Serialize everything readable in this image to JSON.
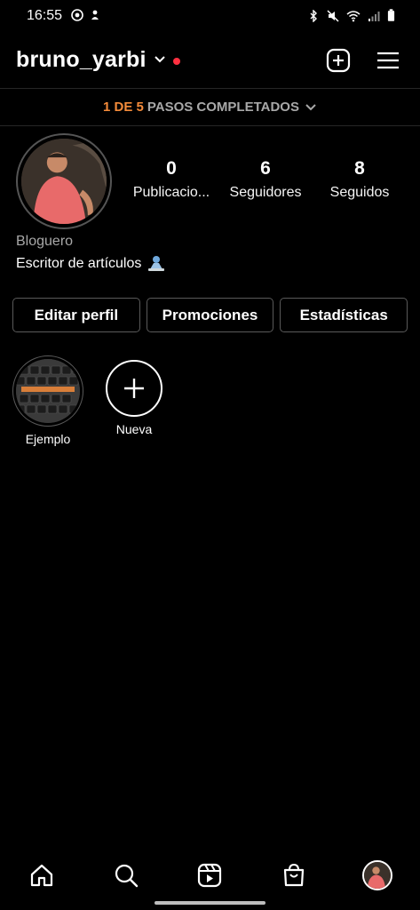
{
  "status_bar": {
    "time": "16:55",
    "left_icons": [
      "media-icon",
      "notification-icon"
    ],
    "right_icons": [
      "bluetooth-icon",
      "mute-icon",
      "wifi-icon",
      "signal-icon",
      "battery-icon"
    ]
  },
  "header": {
    "username": "bruno_yarbi",
    "has_notification_dot": true,
    "notification_dot_color": "#ff3040"
  },
  "steps": {
    "progress": "1 DE 5",
    "label": "PASOS COMPLETADOS",
    "accent_color": "#f48b3a"
  },
  "profile": {
    "stats": [
      {
        "value": "0",
        "label": "Publicacio..."
      },
      {
        "value": "6",
        "label": "Seguidores"
      },
      {
        "value": "8",
        "label": "Seguidos"
      }
    ],
    "category": "Bloguero",
    "bio": "Escritor de artículos"
  },
  "buttons": {
    "edit_profile": "Editar perfil",
    "promotions": "Promociones",
    "statistics": "Estadísticas"
  },
  "highlights": [
    {
      "label": "Ejemplo"
    },
    {
      "label": "Nueva"
    }
  ],
  "bottom_nav": [
    "home-icon",
    "search-icon",
    "reels-icon",
    "shop-icon",
    "profile-avatar"
  ]
}
